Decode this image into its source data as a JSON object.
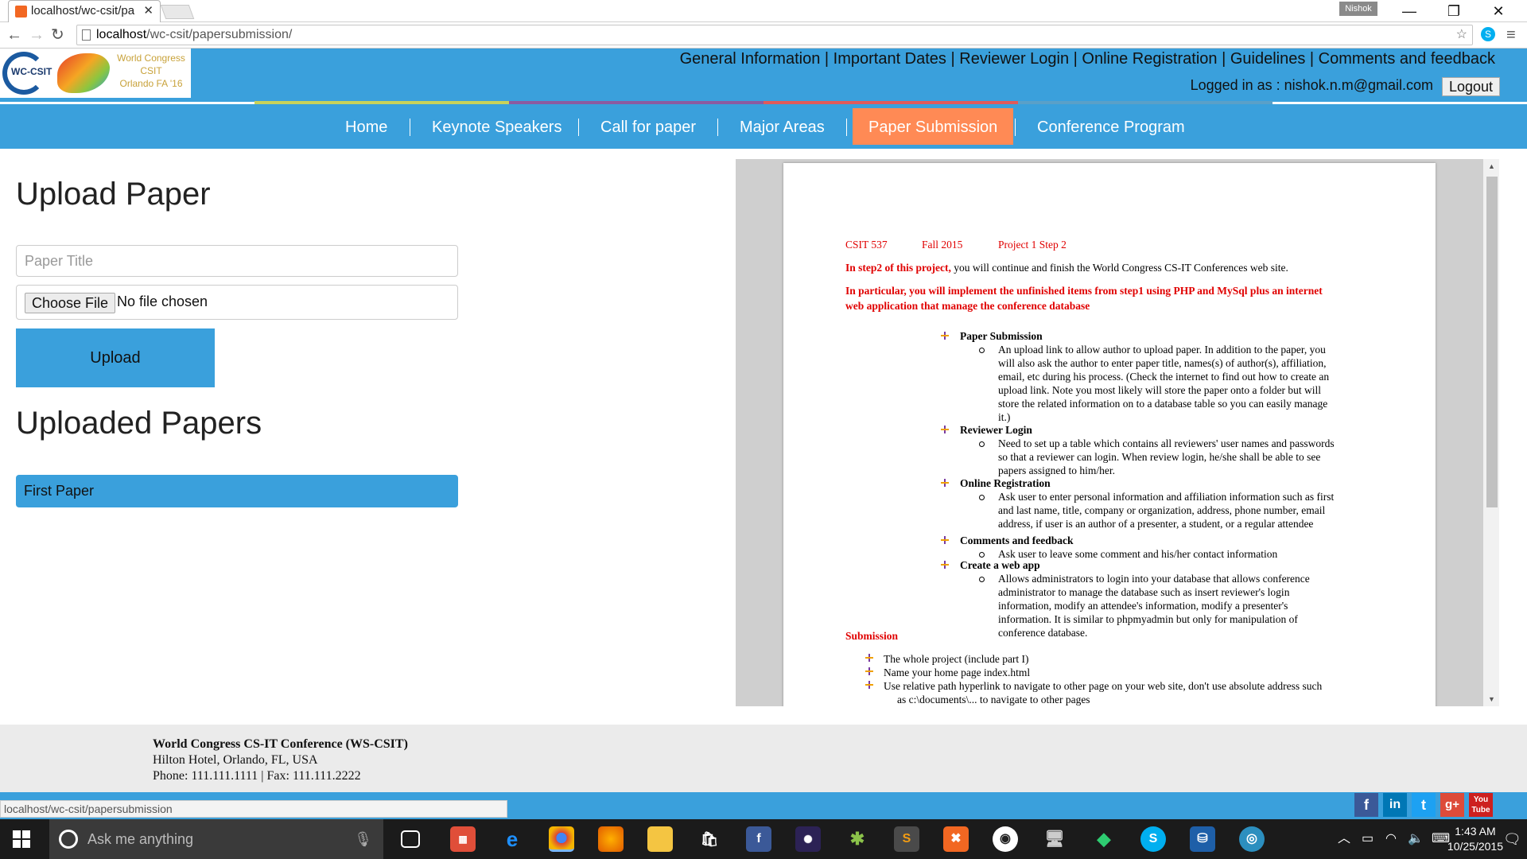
{
  "browser": {
    "tab_title": "localhost/wc-csit/pa",
    "profile_name": "Nishok",
    "url_host": "localhost",
    "url_path": "/wc-csit/papersubmission/",
    "status_url": "localhost/wc-csit/papersubmission"
  },
  "header": {
    "logo_abbr": "WC-CSIT",
    "logo_line1": "World Congress",
    "logo_line2": "CSIT",
    "logo_line3": "Orlando FA '16",
    "top_links": [
      "General Information",
      "Important Dates",
      "Reviewer Login",
      "Online Registration",
      "Guidelines",
      "Comments and feedback"
    ],
    "separator": " | ",
    "logged_in_text": "Logged in as : nishok.n.m@gmail.com",
    "logout_label": "Logout"
  },
  "main_nav": {
    "items": [
      "Home",
      "Keynote Speakers",
      "Call for paper",
      "Major Areas",
      "Paper Submission",
      "Conference Program"
    ],
    "active_index": 4
  },
  "upload": {
    "heading": "Upload Paper",
    "title_placeholder": "Paper Title",
    "choose_file_label": "Choose File",
    "no_file_text": "No file chosen",
    "upload_button": "Upload"
  },
  "uploaded": {
    "heading": "Uploaded Papers",
    "items": [
      "First Paper"
    ]
  },
  "pdf": {
    "course": "CSIT 537",
    "term": "Fall 2015",
    "project": "Project 1 Step 2",
    "intro_red": "In step2 of this project,",
    "intro_rest": " you will continue and finish the World Congress CS-IT Conferences web site.",
    "particular_1": "In particular, you will implement the unfinished items from step1 using PHP and MySql plus an internet",
    "particular_2": "web application that manage the conference database",
    "sections": [
      {
        "title": "Paper Submission",
        "lines": [
          "An upload link to allow author to upload paper. In addition to the paper, you",
          "will also ask the author to enter paper title, names(s) of author(s), affiliation,",
          "email, etc during his process. (Check the internet to find out how to create an",
          "upload link. Note you most likely will store the paper onto a folder but will",
          "store the related information on to a database table so you can easily manage",
          "it.)"
        ]
      },
      {
        "title": "Reviewer Login",
        "lines": [
          "Need to set up a table which contains all reviewers' user names and passwords",
          "so that a reviewer can login. When review login, he/she shall be able to see",
          "papers assigned to him/her."
        ]
      },
      {
        "title": "Online Registration",
        "lines": [
          "Ask user to enter personal information and affiliation information such as first",
          "and last name, title, company or organization, address, phone number, email",
          "address, if user is an author of a presenter, a student, or a regular attendee"
        ]
      },
      {
        "title": "Comments and feedback",
        "lines": [
          "Ask user to leave some comment and his/her contact information"
        ]
      },
      {
        "title": "Create a web app",
        "lines": [
          "Allows administrators to login into your database that allows conference",
          "administrator to manage the database such as insert reviewer's login",
          "information, modify an attendee's information, modify a presenter's",
          "information. It is similar to phpmyadmin but only for manipulation of",
          "conference database."
        ]
      }
    ],
    "submission_heading": "Submission",
    "submission_items": [
      "The whole project (include part I)",
      "Name your home page index.html",
      "Use relative path hyperlink to navigate to other page on your web site, don't use absolute address such"
    ],
    "submission_cont": "as c:\\documents\\... to navigate to other pages"
  },
  "footer": {
    "name": "World Congress CS-IT Conference (WS-CSIT)",
    "address": "Hilton Hotel, Orlando, FL, USA",
    "contact": "Phone: 111.111.1111 | Fax: 111.111.2222"
  },
  "social": [
    "f",
    "in",
    "t",
    "g+",
    "You Tube"
  ],
  "taskbar": {
    "search_placeholder": "Ask me anything",
    "time": "1:43 AM",
    "date": "10/25/2015"
  },
  "colors": {
    "brand_blue": "#3aa0dc",
    "active_tab": "#ff8a55",
    "pdf_red": "#e00000"
  }
}
